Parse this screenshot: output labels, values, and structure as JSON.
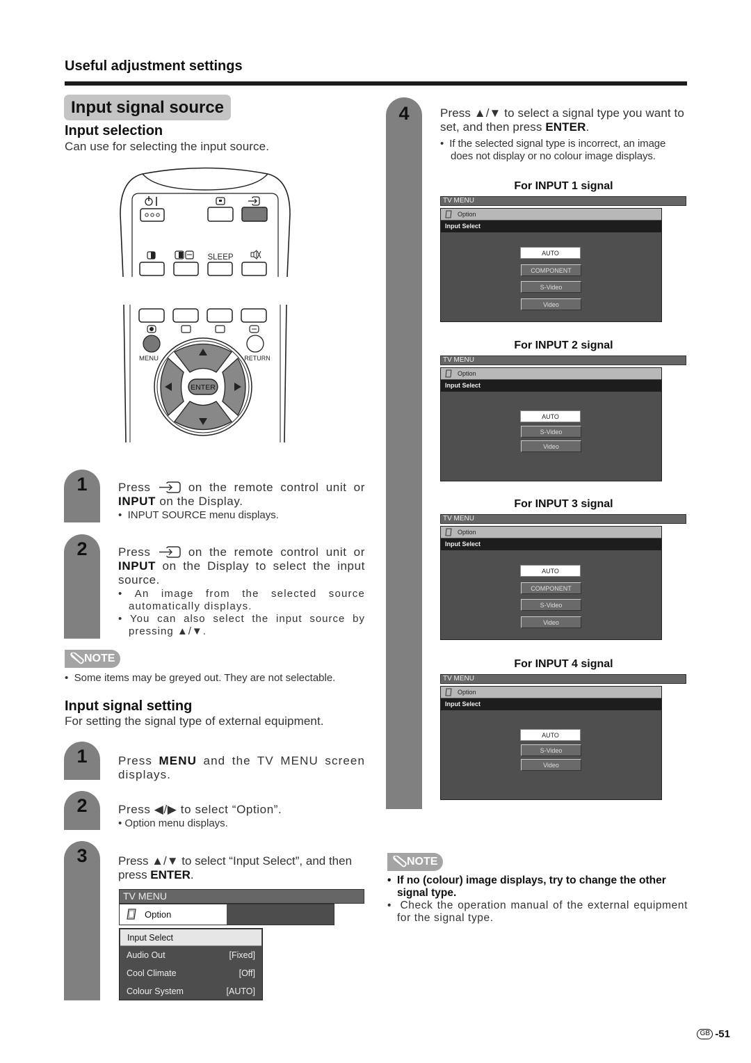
{
  "header": {
    "section_title": "Useful adjustment settings",
    "page_title": "Input signal source"
  },
  "input_selection": {
    "heading": "Input selection",
    "description": "Can use for selecting the input source.",
    "remote": {
      "top_labels": [
        "SLEEP"
      ],
      "nav_labels": {
        "menu": "MENU",
        "return": "RETURN",
        "enter": "ENTER"
      }
    },
    "steps": [
      {
        "number": "1",
        "text_prefix": "Press",
        "text_mid": "on the remote control unit or",
        "bold": "INPUT",
        "text_suffix": "on the Display.",
        "bullets": [
          "INPUT SOURCE menu displays."
        ]
      },
      {
        "number": "2",
        "text_prefix": "Press",
        "text_mid": "on the remote control unit or",
        "bold": "INPUT",
        "text_suffix": "on the Display to select the input source.",
        "bullets": [
          "An image from the selected source automatically displays.",
          "You can also select the input source by pressing ▲/▼."
        ]
      }
    ],
    "note": {
      "badge": "NOTE",
      "items": [
        "Some items may be greyed out. They are not selectable."
      ]
    }
  },
  "input_signal_setting": {
    "heading": "Input signal setting",
    "description": "For setting the signal type of external equipment.",
    "steps": [
      {
        "number": "1",
        "pre": "Press ",
        "bold": "MENU",
        "post": " and the TV MENU screen displays.",
        "bullets": []
      },
      {
        "number": "2",
        "pre": "Press ◀/▶ to select “Option”.",
        "bold": "",
        "post": "",
        "bullets": [
          "Option menu displays."
        ]
      },
      {
        "number": "3",
        "pre": "Press ▲/▼ to select “Input Select”, and then press ",
        "bold": "ENTER",
        "post": ".",
        "bullets": []
      }
    ],
    "tv_menu": {
      "bar": "TV MENU",
      "option": "Option",
      "items": [
        {
          "label": "Input Select",
          "value": "",
          "highlighted": true
        },
        {
          "label": "Audio Out",
          "value": "[Fixed]"
        },
        {
          "label": "Cool Climate",
          "value": "[Off]"
        },
        {
          "label": "Colour System",
          "value": "[AUTO]"
        }
      ]
    }
  },
  "step4": {
    "number": "4",
    "pre": "Press ▲/▼ to select a signal type you want to set, and then press ",
    "bold": "ENTER",
    "post": ".",
    "bullets": [
      "If the selected signal type is incorrect, an image does not display or no colour image displays."
    ],
    "signals": [
      {
        "caption": "For INPUT 1 signal",
        "bar": "TV MENU",
        "option": "Option",
        "header": "Input Select",
        "buttons": [
          "AUTO",
          "COMPONENT",
          "S-Video",
          "Video"
        ],
        "selected": 0
      },
      {
        "caption": "For INPUT 2 signal",
        "bar": "TV MENU",
        "option": "Option",
        "header": "Input Select",
        "buttons": [
          "AUTO",
          "S-Video",
          "Video"
        ],
        "selected": 0
      },
      {
        "caption": "For INPUT 3 signal",
        "bar": "TV MENU",
        "option": "Option",
        "header": "Input Select",
        "buttons": [
          "AUTO",
          "COMPONENT",
          "S-Video",
          "Video"
        ],
        "selected": 0
      },
      {
        "caption": "For INPUT 4 signal",
        "bar": "TV MENU",
        "option": "Option",
        "header": "Input Select",
        "buttons": [
          "AUTO",
          "S-Video",
          "Video"
        ],
        "selected": 0
      }
    ]
  },
  "note2": {
    "badge": "NOTE",
    "bold_item": "If no (colour) image displays, try to change the other signal type.",
    "item": "Check the operation manual of the external equipment for the signal type."
  },
  "footer": {
    "region": "GB",
    "page": "-51"
  }
}
